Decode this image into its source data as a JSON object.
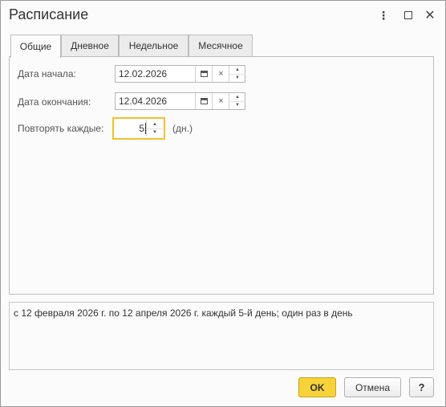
{
  "window": {
    "title": "Расписание",
    "menu_icon": "⋮",
    "close_icon": "✕"
  },
  "tabs": [
    {
      "label": "Общие",
      "active": true
    },
    {
      "label": "Дневное",
      "active": false
    },
    {
      "label": "Недельное",
      "active": false
    },
    {
      "label": "Месячное",
      "active": false
    }
  ],
  "general": {
    "start_label": "Дата начала:",
    "start_value": "12.02.2026",
    "end_label": "Дата окончания:",
    "end_value": "12.04.2026",
    "repeat_label": "Повторять каждые:",
    "repeat_value": "5",
    "repeat_unit": "(дн.)",
    "clear_glyph": "×",
    "up_glyph": "▲",
    "down_glyph": "▼"
  },
  "summary": {
    "text": "с 12 февраля 2026 г. по 12 апреля 2026 г. каждый 5-й день; один раз в день"
  },
  "buttons": {
    "ok": "OK",
    "cancel": "Отмена",
    "help": "?"
  },
  "colors": {
    "ok_button": "#f7d23a",
    "focus_border": "#f2c12e"
  }
}
